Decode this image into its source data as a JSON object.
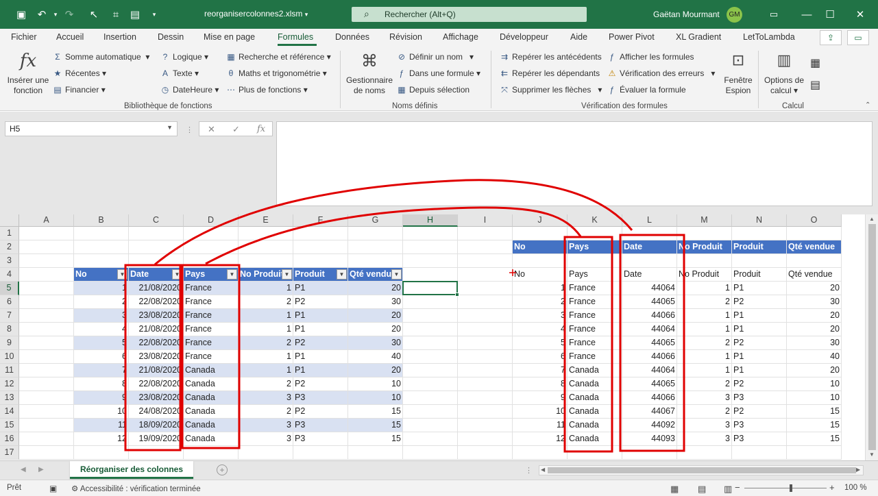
{
  "title_bar": {
    "file_name": "reorganisercolonnes2.xlsm",
    "search_placeholder": "Rechercher (Alt+Q)",
    "user_name": "Gaëtan Mourmant",
    "user_initials": "GM"
  },
  "menu": {
    "tabs": [
      "Fichier",
      "Accueil",
      "Insertion",
      "Dessin",
      "Mise en page",
      "Formules",
      "Données",
      "Révision",
      "Affichage",
      "Développeur",
      "Aide",
      "Power Pivot",
      "XL Gradient",
      "LetToLambda"
    ],
    "active": "Formules"
  },
  "ribbon": {
    "insert_function": "Insérer une fonction",
    "library": {
      "autosum": "Somme automatique",
      "recent": "Récentes",
      "financial": "Financier",
      "logical": "Logique",
      "text": "Texte",
      "datetime": "DateHeure",
      "lookup": "Recherche et référence",
      "math": "Maths et trigonométrie",
      "more": "Plus de fonctions",
      "group_label": "Bibliothèque de fonctions"
    },
    "names": {
      "manager": "Gestionnaire de noms",
      "define": "Définir un nom",
      "use_in_formula": "Dans une formule",
      "create_from_selection": "Depuis sélection",
      "group_label": "Noms définis"
    },
    "audit": {
      "trace_precedents": "Repérer les antécédents",
      "trace_dependents": "Repérer les dépendants",
      "remove_arrows": "Supprimer les flèches",
      "show_formulas": "Afficher les formules",
      "error_checking": "Vérification des erreurs",
      "evaluate": "Évaluer la formule",
      "watch_window": "Fenêtre Espion",
      "group_label": "Vérification des formules"
    },
    "calc": {
      "options": "Options de calcul",
      "group_label": "Calcul"
    }
  },
  "formula_bar": {
    "name_box": "H5",
    "fx": "fx",
    "value": ""
  },
  "grid": {
    "columns": [
      "A",
      "B",
      "C",
      "D",
      "E",
      "F",
      "G",
      "H",
      "I",
      "J",
      "K",
      "L",
      "M",
      "N",
      "O"
    ],
    "rows": [
      "1",
      "2",
      "3",
      "4",
      "5",
      "6",
      "7",
      "8",
      "9",
      "10",
      "11",
      "12",
      "13",
      "14",
      "15",
      "16",
      "17"
    ],
    "selected_column": "H",
    "selected_row": "5",
    "table_headers": [
      "No",
      "Date",
      "Pays",
      "No Produit",
      "Produit",
      "Qté vendue"
    ],
    "table_rows": [
      [
        "1",
        "21/08/2020",
        "France",
        "1",
        "P1",
        "20"
      ],
      [
        "2",
        "22/08/2020",
        "France",
        "2",
        "P2",
        "30"
      ],
      [
        "3",
        "23/08/2020",
        "France",
        "1",
        "P1",
        "20"
      ],
      [
        "4",
        "21/08/2020",
        "France",
        "1",
        "P1",
        "20"
      ],
      [
        "5",
        "22/08/2020",
        "France",
        "2",
        "P2",
        "30"
      ],
      [
        "6",
        "23/08/2020",
        "France",
        "1",
        "P1",
        "40"
      ],
      [
        "7",
        "21/08/2020",
        "Canada",
        "1",
        "P1",
        "20"
      ],
      [
        "8",
        "22/08/2020",
        "Canada",
        "2",
        "P2",
        "10"
      ],
      [
        "9",
        "23/08/2020",
        "Canada",
        "3",
        "P3",
        "10"
      ],
      [
        "10",
        "24/08/2020",
        "Canada",
        "2",
        "P2",
        "15"
      ],
      [
        "11",
        "18/09/2020",
        "Canada",
        "3",
        "P3",
        "15"
      ],
      [
        "12",
        "19/09/2020",
        "Canada",
        "3",
        "P3",
        "15"
      ]
    ],
    "right_headers": [
      "No",
      "Pays",
      "Date",
      "No Produit",
      "Produit",
      "Qté vendue"
    ],
    "right_labels": [
      "No",
      "Pays",
      "Date",
      "No Produit",
      "Produit",
      "Qté vendue"
    ],
    "right_rows": [
      [
        "1",
        "France",
        "44064",
        "1",
        "P1",
        "20"
      ],
      [
        "2",
        "France",
        "44065",
        "2",
        "P2",
        "30"
      ],
      [
        "3",
        "France",
        "44066",
        "1",
        "P1",
        "20"
      ],
      [
        "4",
        "France",
        "44064",
        "1",
        "P1",
        "20"
      ],
      [
        "5",
        "France",
        "44065",
        "2",
        "P2",
        "30"
      ],
      [
        "6",
        "France",
        "44066",
        "1",
        "P1",
        "40"
      ],
      [
        "7",
        "Canada",
        "44064",
        "1",
        "P1",
        "20"
      ],
      [
        "8",
        "Canada",
        "44065",
        "2",
        "P2",
        "10"
      ],
      [
        "9",
        "Canada",
        "44066",
        "3",
        "P3",
        "10"
      ],
      [
        "10",
        "Canada",
        "44067",
        "2",
        "P2",
        "15"
      ],
      [
        "11",
        "Canada",
        "44092",
        "3",
        "P3",
        "15"
      ],
      [
        "12",
        "Canada",
        "44093",
        "3",
        "P3",
        "15"
      ]
    ]
  },
  "sheet_tabs": {
    "active": "Réorganiser des colonnes"
  },
  "status_bar": {
    "ready": "Prêt",
    "accessibility": "Accessibilité : vérification terminée",
    "zoom": "100 %"
  },
  "colors": {
    "excel_green": "#217346",
    "table_header": "#4472c4",
    "table_band": "#d9e1f2",
    "annotation": "#e00000"
  }
}
